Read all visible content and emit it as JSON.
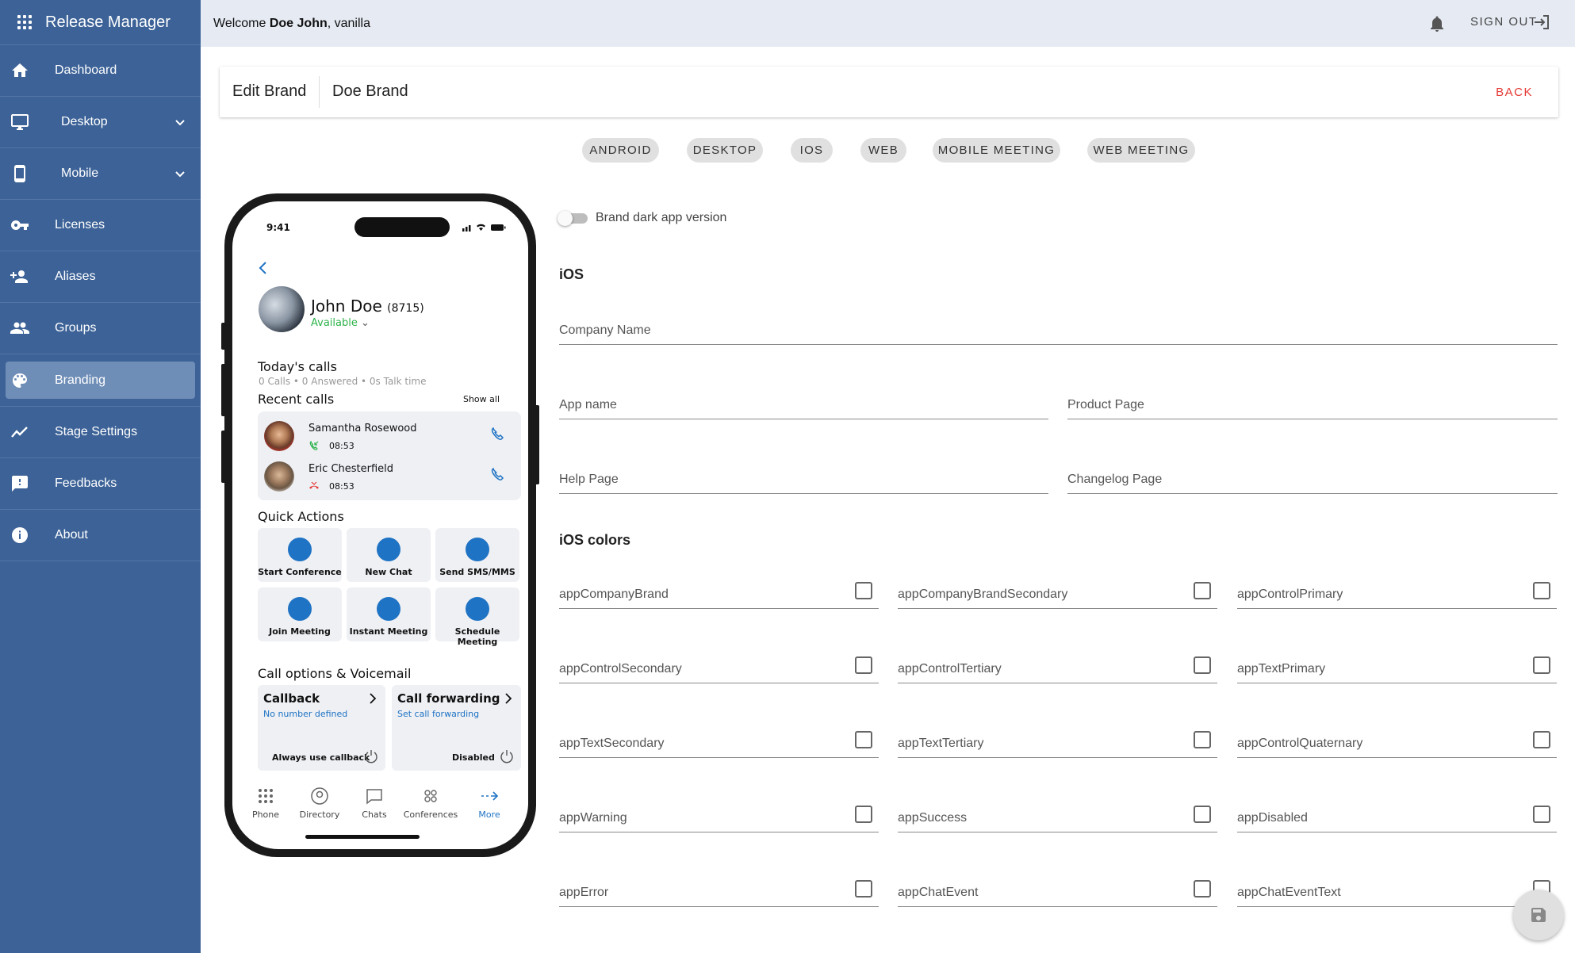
{
  "app": {
    "title": "Release Manager"
  },
  "sidebar": {
    "items": [
      {
        "label": "Dashboard",
        "icon": "home-icon"
      },
      {
        "label": "Desktop",
        "icon": "desktop-icon"
      },
      {
        "label": "Mobile",
        "icon": "mobile-icon"
      },
      {
        "label": "Licenses",
        "icon": "key-icon"
      },
      {
        "label": "Aliases",
        "icon": "person-add-icon"
      },
      {
        "label": "Groups",
        "icon": "group-icon"
      },
      {
        "label": "Branding",
        "icon": "palette-icon"
      },
      {
        "label": "Stage Settings",
        "icon": "trend-icon"
      },
      {
        "label": "Feedbacks",
        "icon": "feedback-icon"
      },
      {
        "label": "About",
        "icon": "info-icon"
      }
    ]
  },
  "topbar": {
    "welcome_prefix": "Welcome ",
    "user_name": "Doe John",
    "tenant_suffix": ", vanilla",
    "sign_out": "SIGN OUT"
  },
  "header": {
    "title": "Edit Brand",
    "brand_name": "Doe Brand",
    "back": "BACK"
  },
  "tabs": [
    "ANDROID",
    "DESKTOP",
    "IOS",
    "WEB",
    "MOBILE MEETING",
    "WEB MEETING"
  ],
  "phone": {
    "time": "9:41",
    "contact_name": "John Doe",
    "contact_ext": "(8715)",
    "status": "Available",
    "todays_calls_title": "Today's calls",
    "todays_calls_stats": "0 Calls • 0 Answered • 0s Talk time",
    "recent_calls_title": "Recent calls",
    "show_all": "Show all",
    "recent_calls": [
      {
        "name": "Samantha Rosewood",
        "time": "08:53"
      },
      {
        "name": "Eric Chesterfield",
        "time": "08:53"
      }
    ],
    "quick_actions_title": "Quick Actions",
    "quick_actions": [
      "Start Conference",
      "New Chat",
      "Send SMS/MMS",
      "Join Meeting",
      "Instant Meeting",
      "Schedule Meeting"
    ],
    "call_options_title": "Call options & Voicemail",
    "callback": {
      "title": "Callback",
      "subtitle": "No number defined",
      "footer": "Always use callback"
    },
    "forwarding": {
      "title": "Call forwarding",
      "subtitle": "Set call forwarding",
      "footer": "Disabled"
    },
    "nav": [
      "Phone",
      "Directory",
      "Chats",
      "Conferences",
      "More"
    ],
    "accent_color": "#1f73c4"
  },
  "form": {
    "dark_toggle_label": "Brand dark app version",
    "dark_toggle_on": false,
    "section_title": "iOS",
    "company_name_label": "Company Name",
    "app_name_label": "App name",
    "product_page_label": "Product Page",
    "help_page_label": "Help Page",
    "changelog_page_label": "Changelog Page",
    "colors_title": "iOS colors",
    "colors": [
      "appCompanyBrand",
      "appCompanyBrandSecondary",
      "appControlPrimary",
      "appControlSecondary",
      "appControlTertiary",
      "appTextPrimary",
      "appTextSecondary",
      "appTextTertiary",
      "appControlQuaternary",
      "appWarning",
      "appSuccess",
      "appDisabled",
      "appError",
      "appChatEvent",
      "appChatEventText"
    ]
  },
  "theme": {
    "sidebar_bg": "#3c6297",
    "topbar_bg": "#e5eaf3",
    "back_color": "#e53935"
  }
}
